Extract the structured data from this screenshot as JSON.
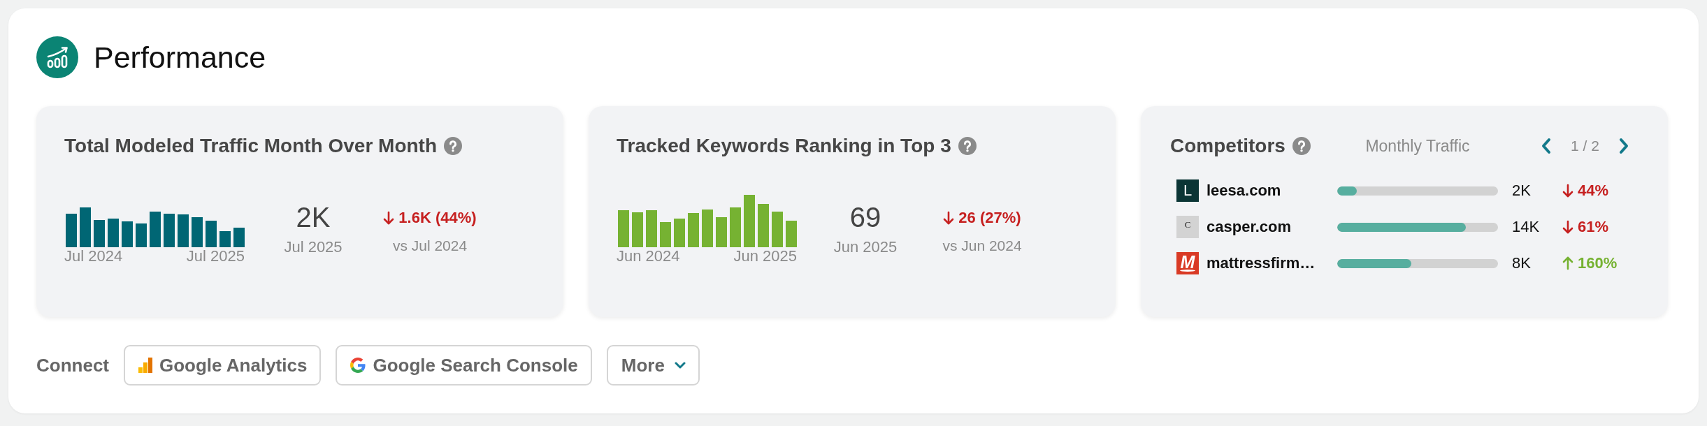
{
  "header": {
    "title": "Performance"
  },
  "metric_cards": [
    {
      "title": "Total Modeled Traffic Month Over Month",
      "sparkline": {
        "color": "#006674",
        "start_label": "Jul 2024",
        "end_label": "Jul 2025"
      },
      "value": "2K",
      "period": "Jul 2025",
      "change": {
        "increase": false,
        "text": "1.6K (44%)"
      },
      "comparison": "vs Jul 2024"
    },
    {
      "title": "Tracked Keywords Ranking in Top 3",
      "sparkline": {
        "color": "#76b232",
        "start_label": "Jun 2024",
        "end_label": "Jun 2025"
      },
      "value": "69",
      "period": "Jun 2025",
      "change": {
        "increase": false,
        "text": "26 (27%)"
      },
      "comparison": "vs Jun 2024"
    }
  ],
  "competitors": {
    "title": "Competitors",
    "column_label": "Monthly Traffic",
    "pager": "1 / 2",
    "rows": [
      {
        "name": "leesa.com",
        "logo": {
          "kind": "dark",
          "text": "L"
        },
        "level": 0.12,
        "traffic": "2K",
        "change": {
          "increase": false,
          "text": "44%"
        }
      },
      {
        "name": "casper.com",
        "logo": {
          "kind": "plain",
          "text": "C"
        },
        "level": 0.8,
        "traffic": "14K",
        "change": {
          "increase": false,
          "text": "61%"
        }
      },
      {
        "name": "mattressfirm…",
        "logo": {
          "kind": "red",
          "text": "M"
        },
        "level": 0.46,
        "traffic": "8K",
        "change": {
          "increase": true,
          "text": "160%"
        }
      }
    ]
  },
  "connect": {
    "label": "Connect",
    "buttons": [
      {
        "kind": "analytics",
        "label": "Google Analytics"
      },
      {
        "kind": "google",
        "label": "Google Search Console"
      },
      {
        "kind": "menu",
        "label": "More"
      }
    ]
  }
}
